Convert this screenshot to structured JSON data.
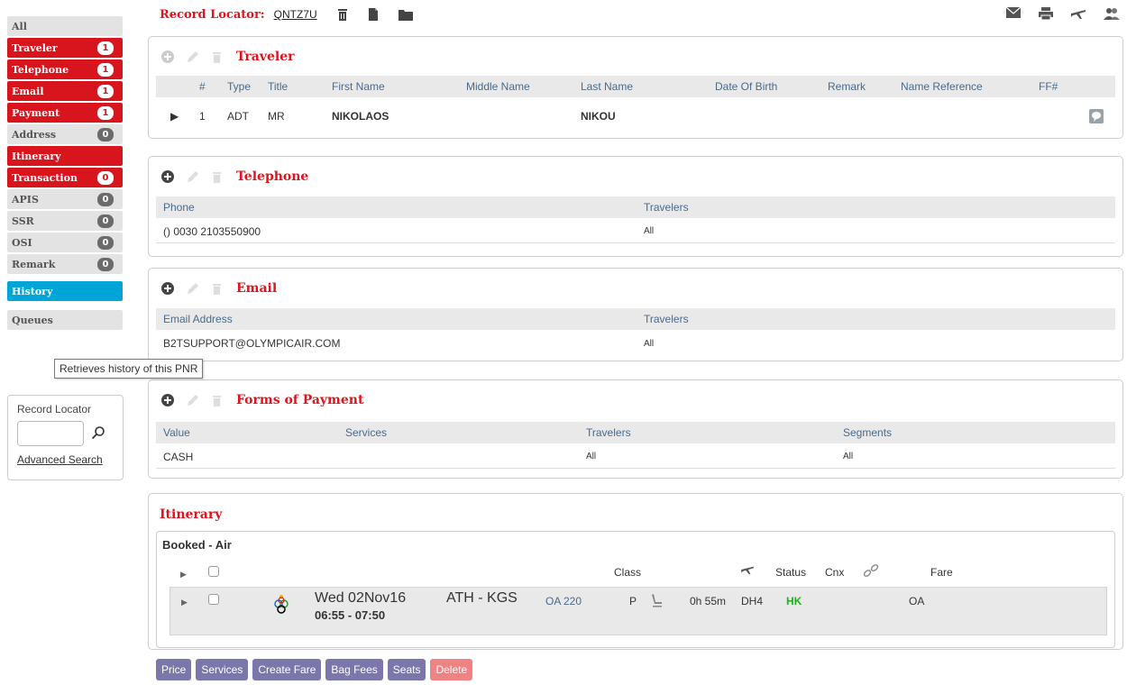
{
  "sidebar": {
    "items": [
      {
        "label": "All",
        "style": "grey",
        "badge": ""
      },
      {
        "label": "Traveler",
        "style": "red",
        "badge": "1"
      },
      {
        "label": "Telephone",
        "style": "red",
        "badge": "1"
      },
      {
        "label": "Email",
        "style": "red",
        "badge": "1"
      },
      {
        "label": "Payment",
        "style": "red",
        "badge": "1"
      },
      {
        "label": "Address",
        "style": "grey",
        "badge": "0"
      },
      {
        "label": "Itinerary",
        "style": "red",
        "badge": ""
      },
      {
        "label": "Transaction",
        "style": "red",
        "badge": "0"
      },
      {
        "label": "APIS",
        "style": "grey",
        "badge": "0"
      },
      {
        "label": "SSR",
        "style": "grey",
        "badge": "0"
      },
      {
        "label": "OSI",
        "style": "grey",
        "badge": "0"
      },
      {
        "label": "Remark",
        "style": "grey",
        "badge": "0"
      }
    ],
    "history_label": "History",
    "queues_label": "Queues",
    "tooltip": "Retrieves history of this PNR",
    "search": {
      "label": "Record Locator",
      "input_value": "",
      "advanced_link": "Advanced Search"
    }
  },
  "header": {
    "record_locator_label": "Record Locator:",
    "record_locator_value": "QNTZ7U",
    "icons": [
      "trash-icon",
      "document-icon",
      "folder-icon"
    ],
    "right_icons": [
      "mail-icon",
      "print-icon",
      "plane-icon",
      "users-icon"
    ]
  },
  "traveler": {
    "title": "Traveler",
    "columns": [
      "#",
      "Type",
      "Title",
      "First Name",
      "Middle Name",
      "Last Name",
      "Date Of Birth",
      "Remark",
      "Name Reference",
      "FF#"
    ],
    "row": {
      "num": "1",
      "type": "ADT",
      "title": "MR",
      "first_name": "NIKOLAOS",
      "middle_name": "",
      "last_name": "NIKOU",
      "dob": "",
      "remark": "",
      "name_ref": "",
      "ff": ""
    }
  },
  "telephone": {
    "title": "Telephone",
    "columns": [
      "Phone",
      "Travelers"
    ],
    "row": {
      "phone": "() 0030 2103550900",
      "travelers": "All"
    }
  },
  "email": {
    "title": "Email",
    "columns": [
      "Email Address",
      "Travelers"
    ],
    "row": {
      "address": "B2TSUPPORT@OLYMPICAIR.COM",
      "travelers": "All"
    }
  },
  "payment": {
    "title": "Forms of Payment",
    "columns": [
      "Value",
      "Services",
      "Travelers",
      "Segments"
    ],
    "row": {
      "value": "CASH",
      "services": "",
      "travelers": "All",
      "segments": "All"
    }
  },
  "itinerary": {
    "title": "Itinerary",
    "booked_title": "Booked - Air",
    "columns": {
      "class": "Class",
      "status": "Status",
      "cnx": "Cnx",
      "fare": "Fare"
    },
    "segment": {
      "date": "Wed 02Nov16",
      "time": "06:55 - 07:50",
      "route": "ATH - KGS",
      "flight": "OA 220",
      "class": "P",
      "duration": "0h 55m",
      "equipment": "DH4",
      "status": "HK",
      "fare": "OA"
    }
  },
  "buttons": {
    "price": "Price",
    "services": "Services",
    "create_fare": "Create Fare",
    "bag_fees": "Bag Fees",
    "seats": "Seats",
    "delete": "Delete"
  },
  "colors": {
    "accent_red": "#e0121b",
    "history_blue": "#00a5d8",
    "button_purple": "#7b77aa",
    "status_green": "#1bb31b"
  }
}
